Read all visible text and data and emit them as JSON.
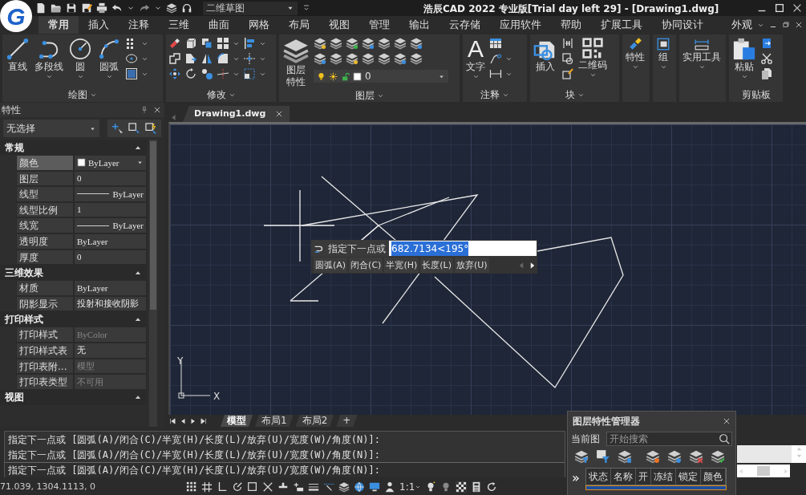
{
  "window": {
    "title": "浩辰CAD 2022 专业版[Trial day left 29] - [Drawing1.dwg]",
    "logo_text": "G"
  },
  "quick_access": {
    "workspace": "二维草图"
  },
  "ribbon_tabs": [
    {
      "label": "常用",
      "selected": true
    },
    {
      "label": "插入",
      "selected": false
    },
    {
      "label": "注释",
      "selected": false
    },
    {
      "label": "三维",
      "selected": false
    },
    {
      "label": "曲面",
      "selected": false
    },
    {
      "label": "网格",
      "selected": false
    },
    {
      "label": "布局",
      "selected": false
    },
    {
      "label": "视图",
      "selected": false
    },
    {
      "label": "管理",
      "selected": false
    },
    {
      "label": "输出",
      "selected": false
    },
    {
      "label": "云存储",
      "selected": false
    },
    {
      "label": "应用软件",
      "selected": false
    },
    {
      "label": "帮助",
      "selected": false
    },
    {
      "label": "扩展工具",
      "selected": false
    },
    {
      "label": "协同设计",
      "selected": false
    }
  ],
  "appearance_menu": "外观",
  "ribbon_panels": [
    {
      "kind": "draw",
      "title": "绘图",
      "tools": [
        "直线",
        "多段线",
        "圆",
        "圆弧"
      ]
    },
    {
      "kind": "modify",
      "title": "修改"
    },
    {
      "kind": "layer",
      "title": "图层",
      "tools": [
        "图层特性"
      ],
      "current_layer": "0"
    },
    {
      "kind": "annotate",
      "title": "注释",
      "tools": [
        "文字"
      ],
      "icon_text": "A"
    },
    {
      "kind": "block",
      "title": "块",
      "tools": [
        "插入",
        "二维码"
      ]
    },
    {
      "kind": "properties",
      "tools": [
        "特性"
      ]
    },
    {
      "kind": "group",
      "tools": [
        "组"
      ]
    },
    {
      "kind": "utilities",
      "tools": [
        "实用工具"
      ]
    },
    {
      "kind": "clipboard",
      "title": "剪贴板",
      "tools": [
        "粘贴"
      ]
    }
  ],
  "properties_panel": {
    "title": "特性",
    "selection": "无选择",
    "sections": [
      {
        "title": "常规",
        "expanded": true,
        "rows": [
          {
            "label": "颜色",
            "value": "ByLayer",
            "kind": "color",
            "selected": true,
            "disabled": false
          },
          {
            "label": "图层",
            "value": "0",
            "kind": "text",
            "selected": false,
            "disabled": false
          },
          {
            "label": "线型",
            "value": "ByLayer",
            "kind": "linetype",
            "selected": false,
            "disabled": false
          },
          {
            "label": "线型比例",
            "value": "1",
            "kind": "text",
            "selected": false,
            "disabled": false
          },
          {
            "label": "线宽",
            "value": "ByLayer",
            "kind": "linetype",
            "selected": false,
            "disabled": false
          },
          {
            "label": "透明度",
            "value": "ByLayer",
            "kind": "text",
            "selected": false,
            "disabled": false
          },
          {
            "label": "厚度",
            "value": "0",
            "kind": "text",
            "selected": false,
            "disabled": false
          }
        ]
      },
      {
        "title": "三维效果",
        "expanded": true,
        "rows": [
          {
            "label": "材质",
            "value": "ByLayer",
            "kind": "text",
            "selected": false,
            "disabled": false
          },
          {
            "label": "阴影显示",
            "value": "投射和接收阴影",
            "kind": "text",
            "selected": false,
            "disabled": false
          }
        ]
      },
      {
        "title": "打印样式",
        "expanded": true,
        "rows": [
          {
            "label": "打印样式",
            "value": "ByColor",
            "kind": "text",
            "selected": false,
            "disabled": true
          },
          {
            "label": "打印样式表",
            "value": "无",
            "kind": "text",
            "selected": false,
            "disabled": false
          },
          {
            "label": "打印表附...",
            "value": "模型",
            "kind": "text",
            "selected": false,
            "disabled": true
          },
          {
            "label": "打印表类型",
            "value": "不可用",
            "kind": "text",
            "selected": false,
            "disabled": true
          }
        ]
      },
      {
        "title": "视图",
        "expanded": true
      }
    ]
  },
  "document_tabs": [
    {
      "label": "Drawing1.dwg",
      "selected": true
    }
  ],
  "canvas": {
    "prompt": "指定下一点或",
    "input_value": "682.7134<195°",
    "options": [
      "圆弧(A)",
      "闭合(C)",
      "半宽(H)",
      "长度(L)",
      "放弃(U)"
    ],
    "axis_y": "Y",
    "axis_x": "X"
  },
  "layout_tabs": [
    {
      "label": "模型",
      "selected": true
    },
    {
      "label": "布局1",
      "selected": false
    },
    {
      "label": "布局2",
      "selected": false
    },
    {
      "label": "+",
      "selected": false
    }
  ],
  "command_history": [
    "指定下一点或 [圆弧(A)/闭合(C)/半宽(H)/长度(L)/放弃(U)/宽度(W)/角度(N)]:",
    "指定下一点或 [圆弧(A)/闭合(C)/半宽(H)/长度(L)/放弃(U)/宽度(W)/角度(N)]:",
    "指定下一点或 [圆弧(A)/闭合(C)/半宽(H)/长度(L)/放弃(U)/宽度(W)/角度(N)]:"
  ],
  "status_bar": {
    "coordinates": "71.039, 1304.1113, 0",
    "scale": "1:1"
  },
  "layer_manager": {
    "title": "图层特性管理器",
    "current_label": "当前图",
    "search_placeholder": "开始搜索",
    "expand_button": "»",
    "columns": [
      "状态",
      "名称",
      "开",
      "冻结",
      "锁定",
      "颜色"
    ]
  }
}
